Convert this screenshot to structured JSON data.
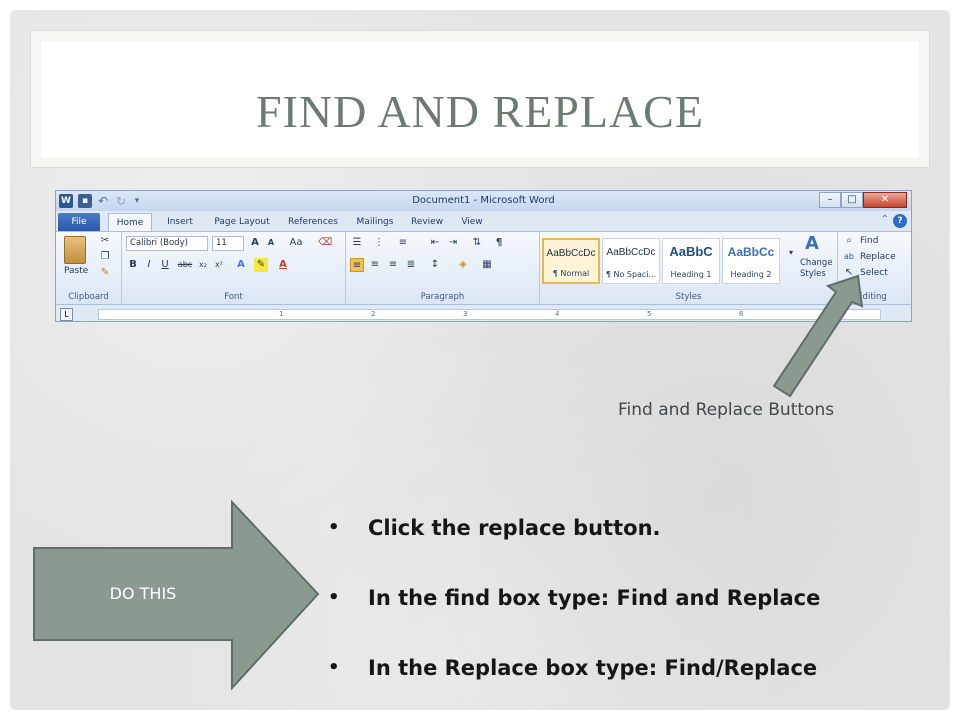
{
  "slide": {
    "title": "FIND AND REPLACE",
    "callout_label": "Find and Replace Buttons",
    "arrow_label": "DO THIS",
    "bullets": [
      "Click the replace button.",
      "In the find box type: Find and Replace",
      "In the Replace box type: Find/Replace"
    ]
  },
  "word": {
    "window_title": "Document1 - Microsoft Word",
    "logo": "W",
    "tabs": [
      "File",
      "Home",
      "Insert",
      "Page Layout",
      "References",
      "Mailings",
      "Review",
      "View"
    ],
    "clipboard": {
      "paste_label": "Paste",
      "group_label": "Clipboard"
    },
    "font": {
      "font_name": "Calibri (Body)",
      "font_size": "11",
      "group_label": "Font",
      "aa_label": "Aa"
    },
    "paragraph": {
      "group_label": "Paragraph"
    },
    "styles": {
      "group_label": "Styles",
      "items": [
        {
          "sample": "AaBbCcDc",
          "name": "¶ Normal"
        },
        {
          "sample": "AaBbCcDc",
          "name": "¶ No Spaci..."
        },
        {
          "sample": "AaBbC",
          "name": "Heading 1"
        },
        {
          "sample": "AaBbCc",
          "name": "Heading 2"
        }
      ],
      "change_styles": [
        "Change",
        "Styles"
      ]
    },
    "editing": {
      "group_label": "Editing",
      "find": "Find",
      "replace": "Replace",
      "select": "Select"
    },
    "ruler_marks": [
      "1",
      "2",
      "3",
      "4",
      "5",
      "6"
    ]
  },
  "colors": {
    "title": "#6b7b70",
    "arrow_fill": "#8a9a90",
    "arrow_stroke": "#5f6f66",
    "file_tab": "#2a58a8"
  },
  "icons": {
    "cut": "scissors-icon",
    "copy": "copy-icon",
    "format_painter": "brush-icon",
    "find": "binoculars-icon",
    "replace": "replace-icon",
    "select": "cursor-icon",
    "help": "help-icon"
  }
}
